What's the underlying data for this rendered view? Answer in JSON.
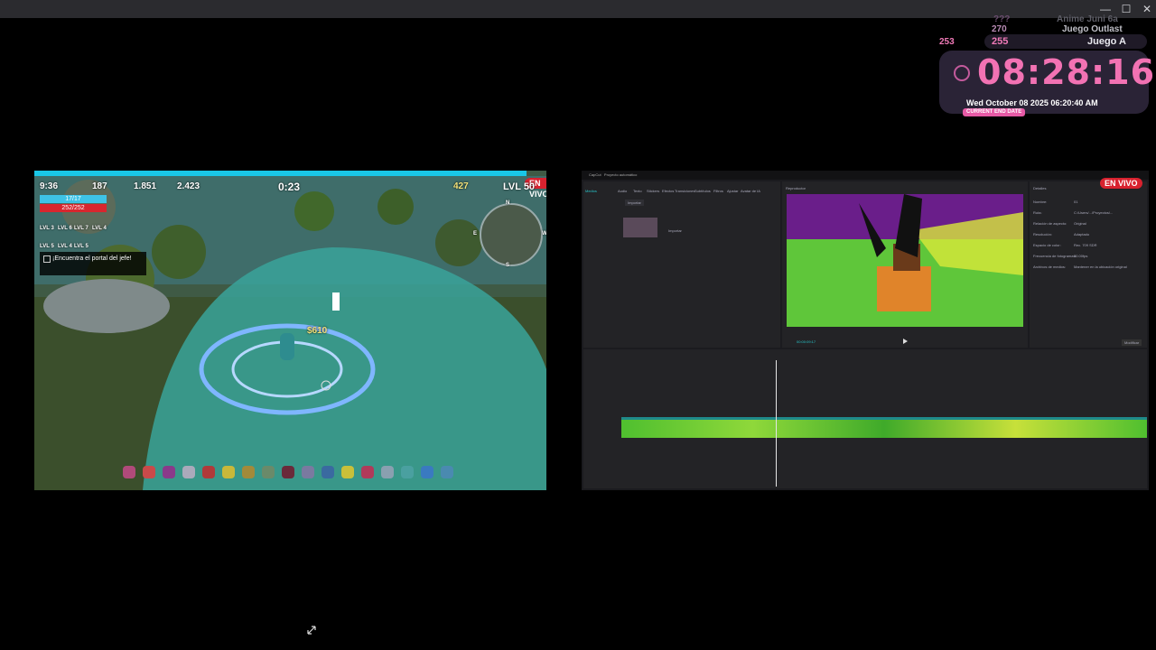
{
  "timer": {
    "rows": [
      {
        "count": "???",
        "name": "Anime Juni 6a"
      },
      {
        "count": "270",
        "name": "Juego Outlast"
      },
      {
        "count": "255",
        "name": "Juego A"
      }
    ],
    "side_count": "253",
    "clock": "08:28:16",
    "date": "Wed October 08 2025 06:20:40 AM",
    "end_label": "CURRENT END DATE"
  },
  "game": {
    "live_badge": "EN VIVO",
    "time": "9:36",
    "gems": "187",
    "coins": "1.851",
    "kills": "2.423",
    "round_timer": "0:23",
    "gold": "427",
    "level": "LVL 50",
    "shield_bar": "17/17",
    "health_bar": "252/252",
    "skill_levels": [
      "LVL 3",
      "LVL 6",
      "LVL 7",
      "LVL 4",
      "LVL 5",
      "LVL 4",
      "LVL 5"
    ],
    "quest": "¡Encuentra el portal del jefe!",
    "money_popup": "$610",
    "minimap": {
      "n": "N",
      "s": "S",
      "e": "E",
      "w": "W"
    }
  },
  "editor": {
    "live_badge": "EN VIVO",
    "app_name": "CapCut",
    "project": "Proyecto automático",
    "tabs": [
      "Medios",
      "Audio",
      "Texto",
      "Stickers",
      "Efectos",
      "Transiciones",
      "Subtítulos",
      "Filtros",
      "Ajustar",
      "Avatar de IA"
    ],
    "import_btn": "Importar",
    "player_title": "Reproductor",
    "details_title": "Detalles",
    "details_rows": [
      {
        "k": "Nombre:",
        "v": "01"
      },
      {
        "k": "Ruta:",
        "v": "C:/Users/.../Proyectos/..."
      },
      {
        "k": "Relación de aspecto:",
        "v": "Original"
      },
      {
        "k": "Resolución:",
        "v": "Adaptado"
      },
      {
        "k": "Espacio de color:",
        "v": "Rec. 709 SDR"
      },
      {
        "k": "Frecuencia de fotogramas:",
        "v": "30.00fps"
      },
      {
        "k": "Archivos de medios:",
        "v": "Mantener en la ubicación original"
      }
    ],
    "modify_btn": "Modificar",
    "timecode": "00:00:09:17",
    "media_caption": "Importar"
  }
}
